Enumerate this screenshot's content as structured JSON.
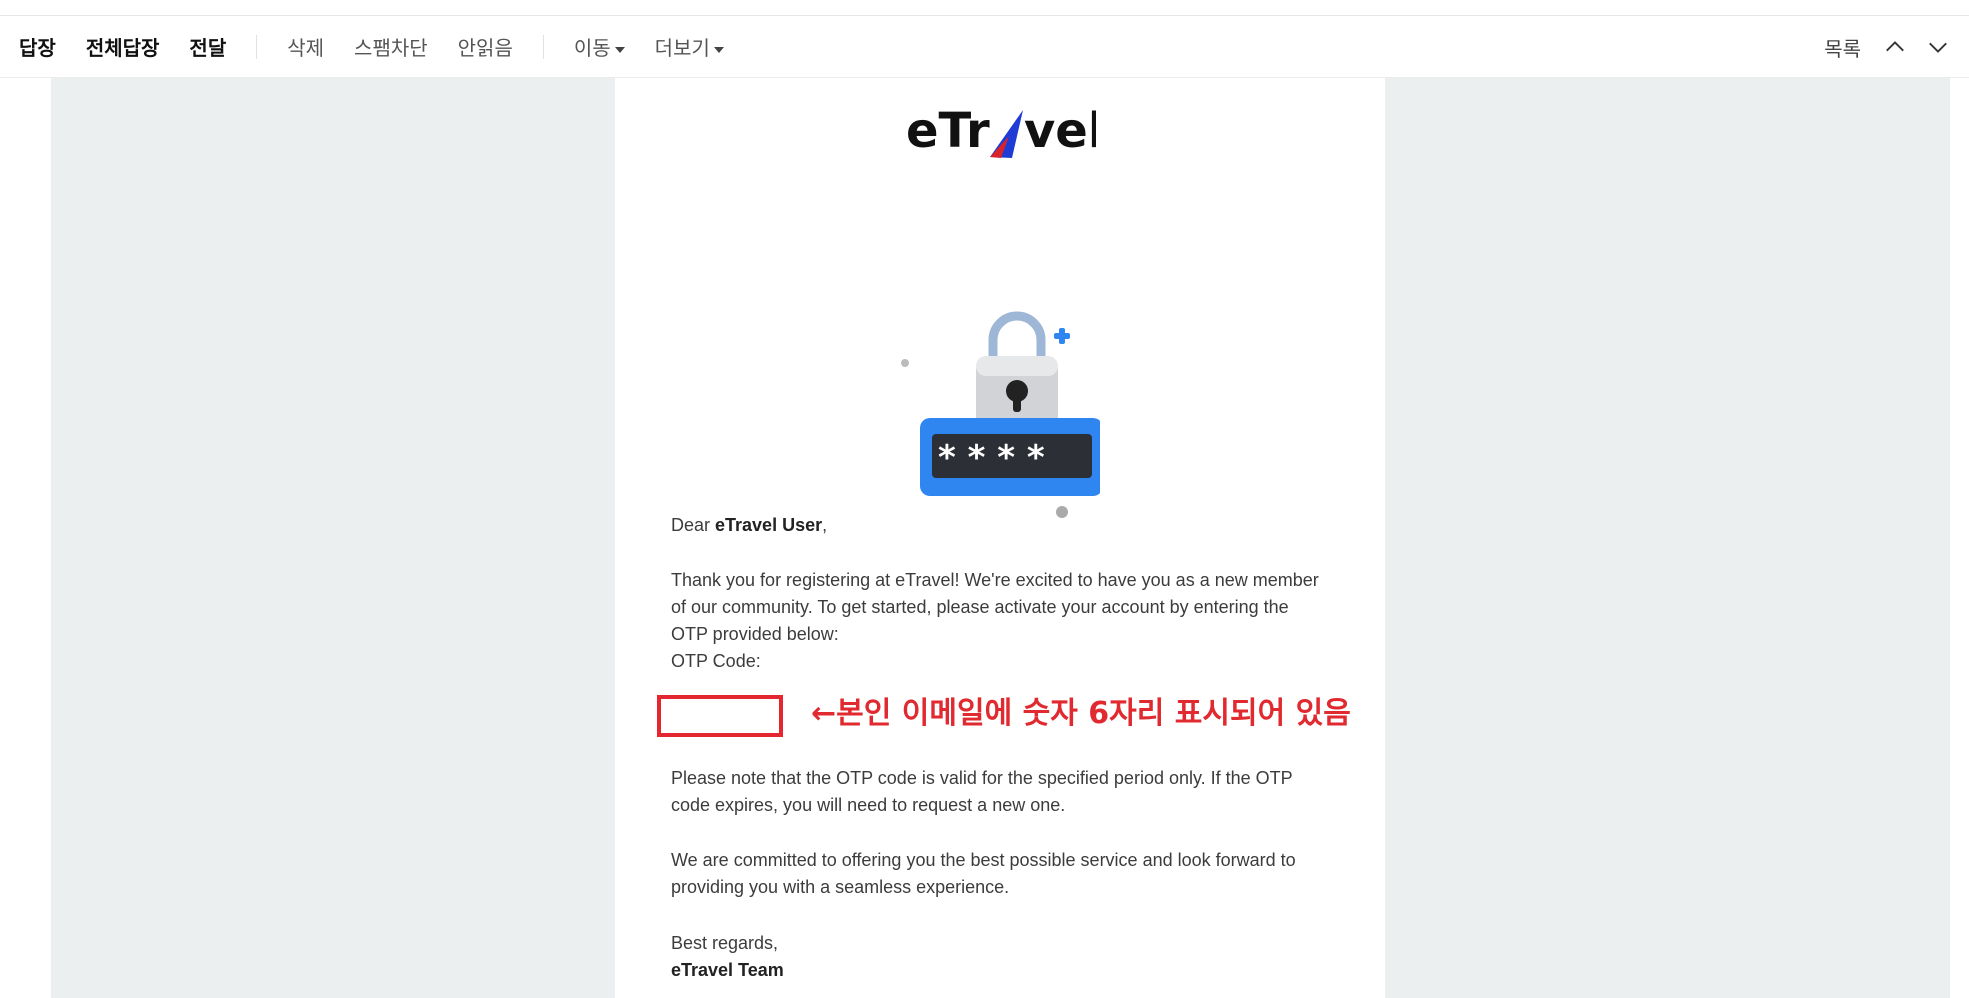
{
  "toolbar": {
    "reply": "답장",
    "reply_all": "전체답장",
    "forward": "전달",
    "delete": "삭제",
    "block_spam": "스팸차단",
    "mark_unread": "안읽음",
    "move": "이동",
    "more": "더보기",
    "list": "목록",
    "icons": [
      "chevron-up-icon",
      "chevron-down-icon"
    ]
  },
  "email": {
    "logo_text_left": "eTr",
    "logo_text_right": "vel",
    "greeting_prefix": "Dear ",
    "greeting_name": "eTravel User",
    "greeting_suffix": ",",
    "para1_line1": "Thank you for registering at eTravel! We're excited to have you as a new member",
    "para1_line2": "of our community. To get started, please activate your account by entering the",
    "para1_line3": "OTP provided below:",
    "otp_label": "OTP Code:",
    "annotation": "←본인 이메일에 숫자 6자리 표시되어 있음",
    "para2_line1": "Please note that the OTP code is valid for the specified period only. If the OTP",
    "para2_line2": "code expires, you will need to request a new one.",
    "para3_line1": "We are committed to offering you the best possible service and look forward to",
    "para3_line2": "providing you with a seamless experience.",
    "regards": "Best regards,",
    "team": "eTravel Team"
  },
  "colors": {
    "annotation_red": "#e02a2f",
    "background_gray": "#eceff0",
    "logo_blue": "#1f3bd6",
    "logo_red": "#d8232a",
    "lock_blue": "#2f86f0"
  }
}
